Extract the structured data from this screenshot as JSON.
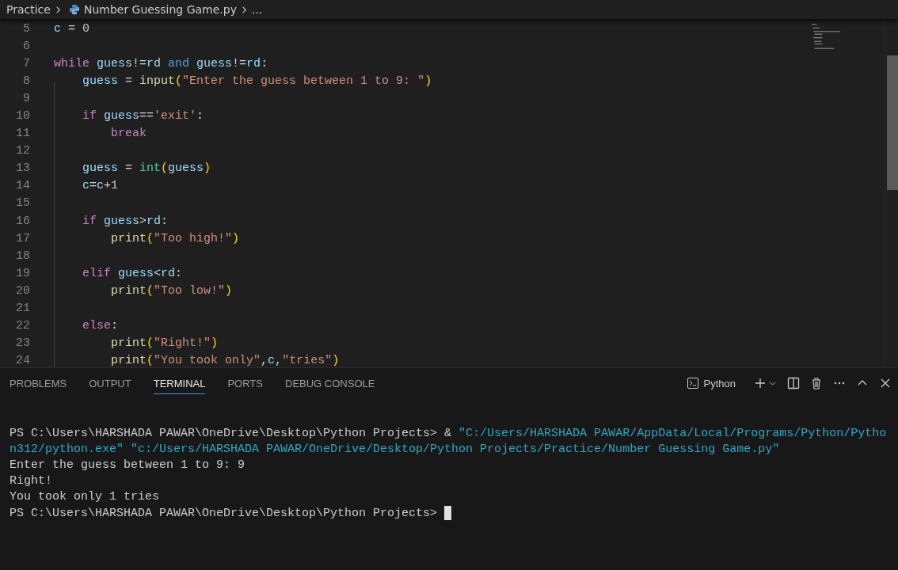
{
  "breadcrumb": {
    "folder": "Practice",
    "file": "Number Guessing Game.py",
    "more": "..."
  },
  "code": [
    {
      "number": "5",
      "tokens": [
        {
          "kind": "var",
          "text": "c"
        },
        {
          "kind": "op",
          "text": " = "
        },
        {
          "kind": "num",
          "text": "0"
        }
      ]
    },
    {
      "number": "6"
    },
    {
      "number": "7",
      "tokens": [
        {
          "kind": "kw",
          "text": "while "
        },
        {
          "kind": "var",
          "text": "guess"
        },
        {
          "kind": "op",
          "text": "!="
        },
        {
          "kind": "var",
          "text": "rd"
        },
        {
          "kind": "bool",
          "text": " and "
        },
        {
          "kind": "var",
          "text": "guess"
        },
        {
          "kind": "op",
          "text": "!="
        },
        {
          "kind": "var",
          "text": "rd"
        },
        {
          "kind": "op",
          "text": ":"
        }
      ]
    },
    {
      "number": "8",
      "tokens": [
        {
          "kind": "var",
          "text": "    guess"
        },
        {
          "kind": "op",
          "text": " = "
        },
        {
          "kind": "func",
          "text": "input"
        },
        {
          "kind": "paren",
          "text": "("
        },
        {
          "kind": "str",
          "text": "\"Enter the guess between 1 to 9: \""
        },
        {
          "kind": "paren",
          "text": ")"
        }
      ]
    },
    {
      "number": "9"
    },
    {
      "number": "10",
      "tokens": [
        {
          "kind": "kw",
          "text": "    if "
        },
        {
          "kind": "var",
          "text": "guess"
        },
        {
          "kind": "op",
          "text": "=="
        },
        {
          "kind": "str",
          "text": "'exit'"
        },
        {
          "kind": "op",
          "text": ":"
        }
      ]
    },
    {
      "number": "11",
      "tokens": [
        {
          "kind": "kw",
          "text": "        break"
        }
      ]
    },
    {
      "number": "12"
    },
    {
      "number": "13",
      "tokens": [
        {
          "kind": "var",
          "text": "    guess"
        },
        {
          "kind": "op",
          "text": " = "
        },
        {
          "kind": "type",
          "text": "int"
        },
        {
          "kind": "paren",
          "text": "("
        },
        {
          "kind": "var",
          "text": "guess"
        },
        {
          "kind": "paren",
          "text": ")"
        }
      ]
    },
    {
      "number": "14",
      "tokens": [
        {
          "kind": "var",
          "text": "    c"
        },
        {
          "kind": "op",
          "text": "="
        },
        {
          "kind": "var",
          "text": "c"
        },
        {
          "kind": "op",
          "text": "+"
        },
        {
          "kind": "num",
          "text": "1"
        }
      ]
    },
    {
      "number": "15"
    },
    {
      "number": "16",
      "tokens": [
        {
          "kind": "kw",
          "text": "    if "
        },
        {
          "kind": "var",
          "text": "guess"
        },
        {
          "kind": "op",
          "text": ">"
        },
        {
          "kind": "var",
          "text": "rd"
        },
        {
          "kind": "op",
          "text": ":"
        }
      ]
    },
    {
      "number": "17",
      "tokens": [
        {
          "kind": "func",
          "text": "        print"
        },
        {
          "kind": "paren",
          "text": "("
        },
        {
          "kind": "str",
          "text": "\"Too high!\""
        },
        {
          "kind": "paren",
          "text": ")"
        }
      ]
    },
    {
      "number": "18"
    },
    {
      "number": "19",
      "tokens": [
        {
          "kind": "kw",
          "text": "    elif "
        },
        {
          "kind": "var",
          "text": "guess"
        },
        {
          "kind": "op",
          "text": "<"
        },
        {
          "kind": "var",
          "text": "rd"
        },
        {
          "kind": "op",
          "text": ":"
        }
      ]
    },
    {
      "number": "20",
      "tokens": [
        {
          "kind": "func",
          "text": "        print"
        },
        {
          "kind": "paren",
          "text": "("
        },
        {
          "kind": "str",
          "text": "\"Too low!\""
        },
        {
          "kind": "paren",
          "text": ")"
        }
      ]
    },
    {
      "number": "21"
    },
    {
      "number": "22",
      "tokens": [
        {
          "kind": "kw",
          "text": "    else"
        },
        {
          "kind": "op",
          "text": ":"
        }
      ]
    },
    {
      "number": "23",
      "tokens": [
        {
          "kind": "func",
          "text": "        print"
        },
        {
          "kind": "paren",
          "text": "("
        },
        {
          "kind": "str",
          "text": "\"Right!\""
        },
        {
          "kind": "paren",
          "text": ")"
        }
      ]
    },
    {
      "number": "24",
      "tokens": [
        {
          "kind": "func",
          "text": "        print"
        },
        {
          "kind": "paren",
          "text": "("
        },
        {
          "kind": "str",
          "text": "\"You took only\""
        },
        {
          "kind": "op",
          "text": ","
        },
        {
          "kind": "var",
          "text": "c"
        },
        {
          "kind": "op",
          "text": ","
        },
        {
          "kind": "str",
          "text": "\"tries\""
        },
        {
          "kind": "paren",
          "text": ")"
        }
      ]
    }
  ],
  "panel_tabs": [
    {
      "label": "PROBLEMS",
      "selected": false
    },
    {
      "label": "OUTPUT",
      "selected": false
    },
    {
      "label": "TERMINAL",
      "selected": true
    },
    {
      "label": "PORTS",
      "selected": false
    },
    {
      "label": "DEBUG CONSOLE",
      "selected": false
    }
  ],
  "terminal_profile": "Python",
  "terminal": [
    {
      "segments": [
        {
          "kind": "plain",
          "text": "PS C:\\Users\\HARSHADA PAWAR\\OneDrive\\Desktop\\Python Projects> & "
        },
        {
          "kind": "path",
          "text": "\"C:/Users/HARSHADA PAWAR/AppData/Local/Programs/Python/Pytho"
        }
      ]
    },
    {
      "segments": [
        {
          "kind": "path",
          "text": "n312/python.exe\" \"c:/Users/HARSHADA PAWAR/OneDrive/Desktop/Python Projects/Practice/Number Guessing Game.py\""
        }
      ]
    },
    {
      "segments": [
        {
          "kind": "plain",
          "text": "Enter the guess between 1 to 9: 9"
        }
      ]
    },
    {
      "segments": [
        {
          "kind": "plain",
          "text": "Right!"
        }
      ]
    },
    {
      "segments": [
        {
          "kind": "plain",
          "text": "You took only 1 tries"
        }
      ]
    },
    {
      "segments": [
        {
          "kind": "plain",
          "text": "PS C:\\Users\\HARSHADA PAWAR\\OneDrive\\Desktop\\Python Projects> "
        }
      ],
      "cursor": true
    }
  ]
}
